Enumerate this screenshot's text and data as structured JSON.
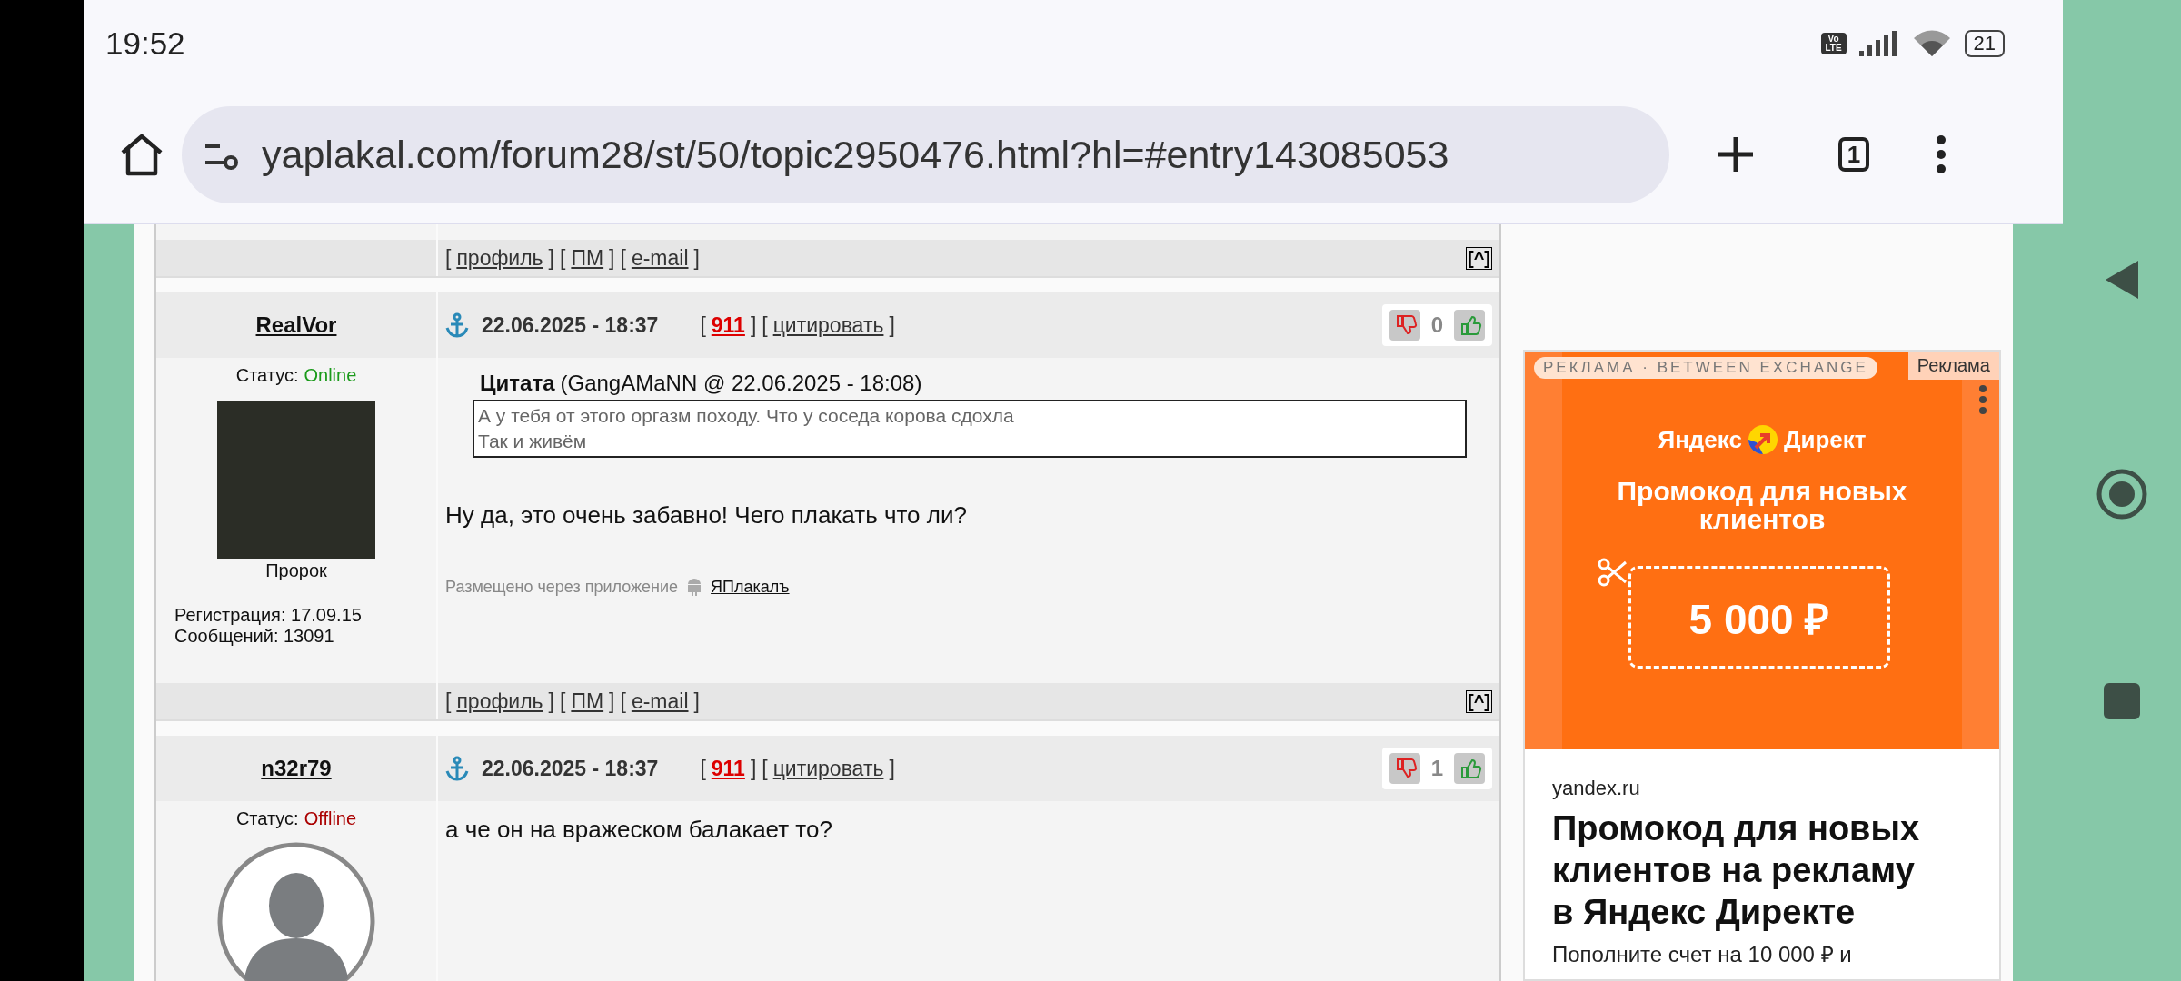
{
  "status_bar": {
    "time": "19:52",
    "network_badge": "Vo LTE",
    "battery": "21"
  },
  "browser": {
    "url": "yaplakal.com/forum28/st/50/topic2950476.html?hl=#entry143085053",
    "tab_count": "1"
  },
  "forum": {
    "rows": [
      {
        "kind": "footer",
        "links": [
          {
            "open": "[",
            "text": "профиль",
            "close": "]",
            "kind": "plain"
          },
          {
            "open": "[",
            "text": "ПМ",
            "close": "]",
            "kind": "plain"
          },
          {
            "open": "[",
            "text": "e-mail",
            "close": "]",
            "kind": "plain"
          }
        ],
        "top": "[^]"
      },
      {
        "kind": "post",
        "author": "RealVor",
        "status_label": "Статус:",
        "status": "Online",
        "online": true,
        "avatar": {
          "kind": "photo"
        },
        "rank": "Пророк",
        "registration": "Регистрация: 17.09.15",
        "messages": "Сообщений: 13091",
        "date": "22.06.2025 - 18:37",
        "links": [
          {
            "open": "[",
            "text": "911",
            "close": "]",
            "kind": "number"
          },
          {
            "open": "[",
            "text": "цитировать",
            "close": "]",
            "kind": "plain"
          }
        ],
        "rating": "0",
        "quote": {
          "title": "Цитата",
          "source": "(GangAMaNN @ 22.06.2025 - 18:08)",
          "lines": [
            "А у тебя от этого оргазм походу. Что у соседа корова сдохла",
            "Так и живём"
          ]
        },
        "text": "Ну да, это очень забавно! Чего плакать что ли?",
        "posted_via": {
          "label": "Размещено через приложение",
          "app": "ЯПлакалъ"
        }
      },
      {
        "kind": "footer",
        "links": [
          {
            "open": "[",
            "text": "профиль",
            "close": "]",
            "kind": "plain"
          },
          {
            "open": "[",
            "text": "ПМ",
            "close": "]",
            "kind": "plain"
          },
          {
            "open": "[",
            "text": "e-mail",
            "close": "]",
            "kind": "plain"
          }
        ],
        "top": "[^]"
      },
      {
        "kind": "post",
        "author": "n32r79",
        "status_label": "Статус:",
        "status": "Offline",
        "online": false,
        "avatar": {
          "kind": "default"
        },
        "date": "22.06.2025 - 18:37",
        "links": [
          {
            "open": "[",
            "text": "911",
            "close": "]",
            "kind": "number"
          },
          {
            "open": "[",
            "text": "цитировать",
            "close": "]",
            "kind": "plain"
          }
        ],
        "rating": "1",
        "text": "а че он на вражеском балакает то?"
      }
    ]
  },
  "ad": {
    "network_label": "РЕКЛАМА · BETWEEN EXCHANGE",
    "ad_label": "Реклама",
    "logo": [
      "Яндекс",
      "Директ"
    ],
    "banner_title": "Промокод для новых клиентов",
    "amount": "5 000 ₽",
    "domain": "yandex.ru",
    "headline": "Промокод для новых клиентов на рекламу в Яндекс Директе",
    "description": "Пополните счет на 10 000 ₽ и"
  }
}
